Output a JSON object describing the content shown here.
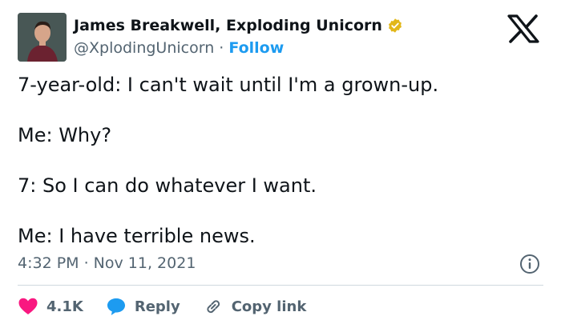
{
  "author": {
    "name": "James Breakwell, Exploding Unicorn",
    "handle": "@XplodingUnicorn",
    "separator": "·",
    "follow_label": "Follow"
  },
  "tweet": {
    "lines": [
      "7-year-old: I can't wait until I'm a grown-up.",
      "Me: Why?",
      "7: So I can do whatever I want.",
      "Me: I have terrible news."
    ],
    "timestamp": "4:32 PM · Nov 11, 2021"
  },
  "actions": {
    "likes_count": "4.1K",
    "reply_label": "Reply",
    "copy_link_label": "Copy link"
  },
  "colors": {
    "like": "#f91880",
    "reply": "#1d9bf0",
    "verified": "#e2b719",
    "follow": "#1d9bf0",
    "muted": "#536471"
  },
  "icons": {
    "like": "heart-icon",
    "reply": "speech-bubble-icon",
    "copy_link": "link-icon",
    "info": "info-icon",
    "brand": "x-logo-icon",
    "verified": "verified-badge-icon"
  }
}
